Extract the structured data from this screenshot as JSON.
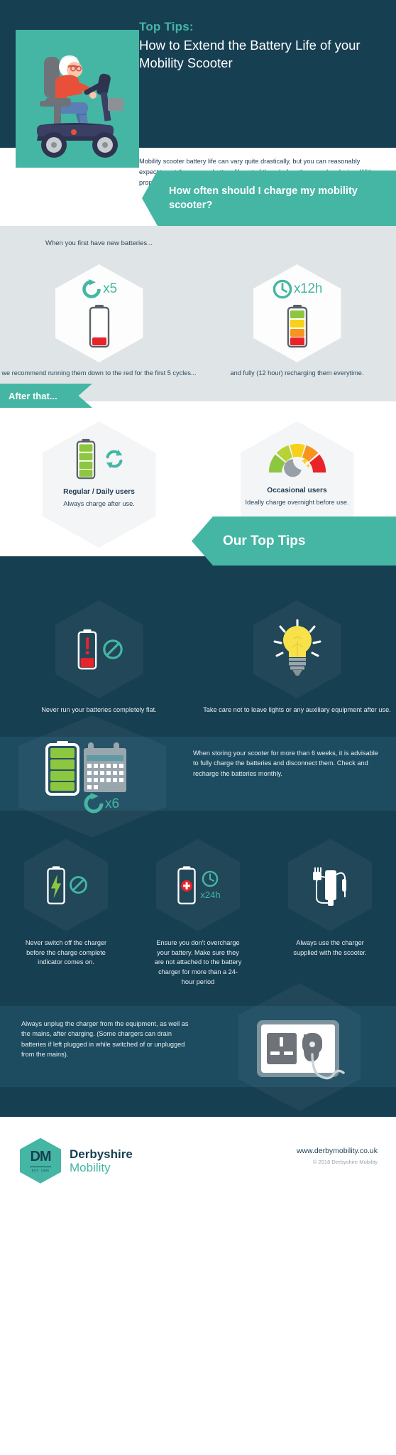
{
  "header": {
    "kicker": "Top Tips:",
    "headline": "How to Extend the Battery Life of your Mobility Scooter",
    "hero_icon": "mobility-scooter-illustration"
  },
  "intro": {
    "paragraph": "Mobility scooter battery life can vary quite drastically, but you can reasonably expect to get three years battery life out of them before they need replacing. With proper care, your mobility scooter batteries can last a lot longer than that."
  },
  "charge_section": {
    "banner_title": "How often should I charge my mobility scooter?",
    "lead": "When you first have new batteries...",
    "items": [
      {
        "badge": "x5",
        "badge_icon": "refresh-cycle-icon",
        "battery_icon": "battery-low-red-icon",
        "caption": "we recommend running them down to the red for the first 5 cycles..."
      },
      {
        "badge": "x12h",
        "badge_icon": "clock-icon",
        "battery_icon": "battery-multicolour-icon",
        "caption": "and fully (12 hour) recharging them everytime."
      }
    ]
  },
  "after_section": {
    "tab_label": "After that...",
    "items": [
      {
        "icon": "battery-full-refresh-icon",
        "title": "Regular / Daily users",
        "subtitle": "Always charge after use."
      },
      {
        "icon": "gauge-moon-icon",
        "title": "Occasional users",
        "subtitle": "Ideally charge overnight before use."
      }
    ]
  },
  "tips_section": {
    "banner_title": "Our Top Tips",
    "row_two": [
      {
        "icon": "battery-warning-prohibited-icon",
        "caption": "Never run your batteries completely flat."
      },
      {
        "icon": "lightbulb-icon",
        "caption": "Take care not to leave lights or any auxiliary equipment after use."
      }
    ],
    "storage": {
      "icon": "battery-calendar-icon",
      "badge": "x6",
      "badge_icon": "refresh-cycle-icon",
      "copy": "When storing your scooter for more than 6 weeks, it is advisable to fully charge the batteries and disconnect them. Check and recharge the batteries monthly."
    },
    "row_three": [
      {
        "icon": "battery-bolt-prohibited-icon",
        "caption": "Never switch off the charger before the charge complete indicator comes on."
      },
      {
        "icon": "battery-plus-clock-icon",
        "badge": "x24h",
        "caption": "Ensure you don't overcharge your battery. Make sure they are not attached to the battery charger for more than a 24-hour period"
      },
      {
        "icon": "charger-plug-icon",
        "caption": "Always use the charger supplied with the scooter."
      }
    ],
    "unplug": {
      "icon": "wall-socket-plug-icon",
      "copy": "Always unplug the charger from the equipment, as well as the mains, after charging. (Some chargers can drain batteries if left plugged in while switched of or unplugged from the mains)."
    }
  },
  "footer": {
    "logo_mark": "DM",
    "logo_est": "EST. 1998",
    "brand_line1": "Derbyshire",
    "brand_line2": "Mobility",
    "website": "www.derbymobility.co.uk",
    "copyright": "© 2018 Derbyshire Mobility"
  },
  "colors": {
    "dark": "#173f52",
    "dark_alt": "#1d4c61",
    "teal": "#45b6a4",
    "grey_band": "#dfe4e6",
    "red": "#e8232a",
    "green": "#8dc63f",
    "yellow": "#f7d117",
    "orange": "#f7941e"
  }
}
